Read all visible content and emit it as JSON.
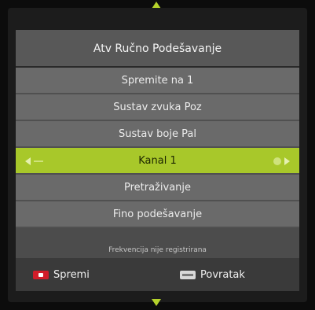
{
  "title": "Atv Ručno Podešavanje",
  "menu": {
    "items": [
      {
        "label": "Spremite na 1"
      },
      {
        "label": "Sustav zvuka Poz"
      },
      {
        "label": "Sustav boje Pal"
      },
      {
        "label": "Kanal 1",
        "selected": true
      },
      {
        "label": "Pretraživanje"
      },
      {
        "label": "Fino podešavanje"
      }
    ]
  },
  "status": "Frekvencija nije registrirana",
  "footer": {
    "save_label": "Spremi",
    "back_label": "Povratak"
  },
  "colors": {
    "accent": "#a8c82a",
    "arrow": "#b5d22b",
    "red_key": "#d21d2a"
  },
  "icons": [
    "arrow-up-icon",
    "arrow-down-icon",
    "left-arrow-icon",
    "right-arrow-icon",
    "red-key-icon",
    "menu-key-icon"
  ]
}
